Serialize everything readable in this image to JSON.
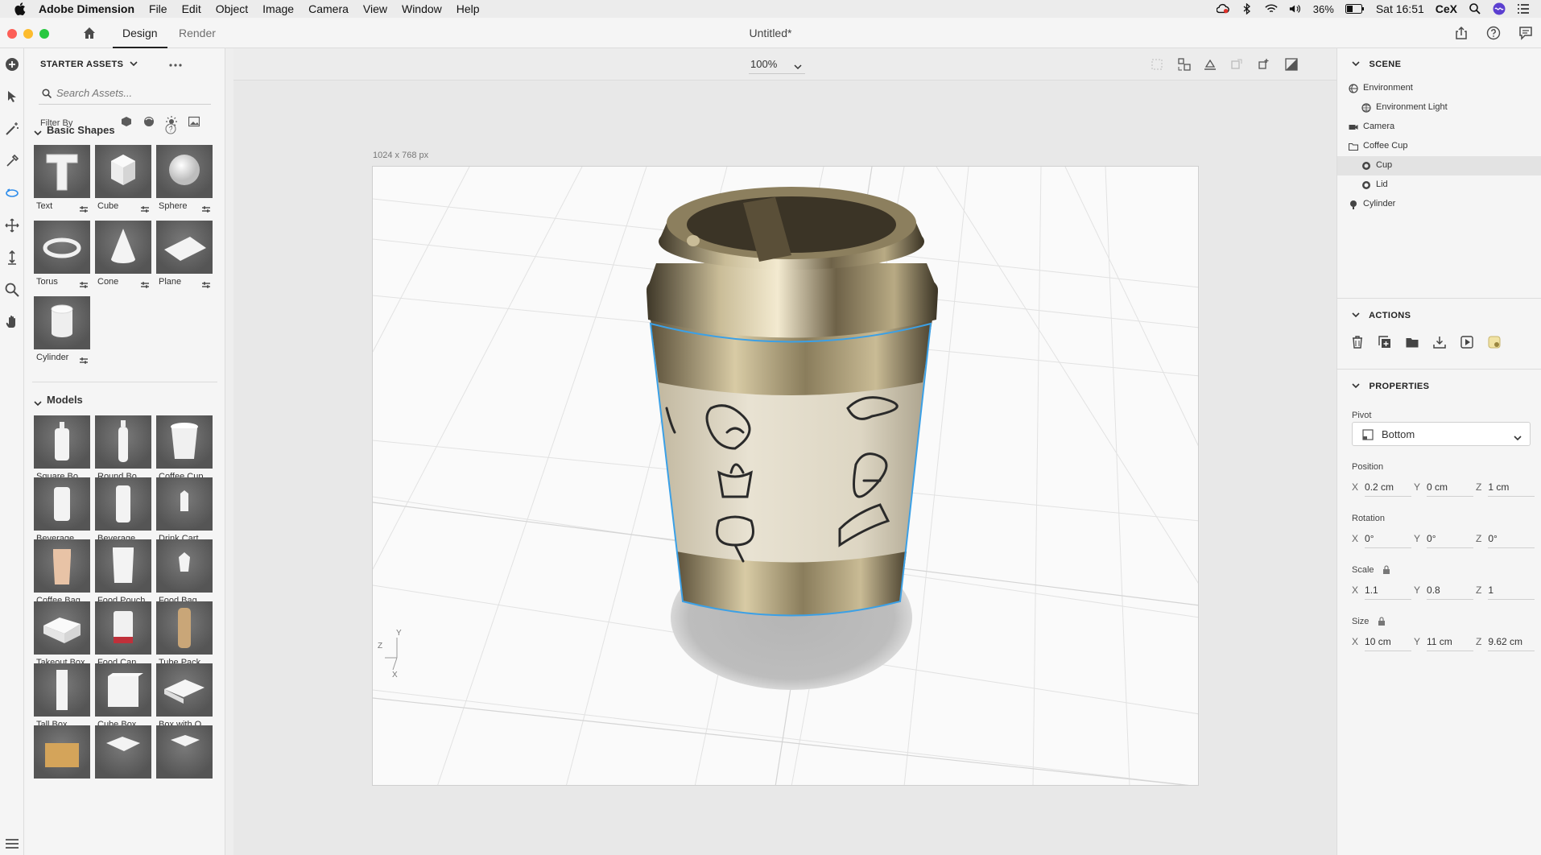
{
  "menubar": {
    "app_name": "Adobe Dimension",
    "menus": [
      "File",
      "Edit",
      "Object",
      "Image",
      "Camera",
      "View",
      "Window",
      "Help"
    ],
    "battery": "36%",
    "clock": "Sat 16:51",
    "user": "CeX"
  },
  "titlebar": {
    "tab_design": "Design",
    "tab_render": "Render",
    "document_title": "Untitled*"
  },
  "assets": {
    "header": "STARTER ASSETS",
    "search_placeholder": "Search Assets...",
    "filter_label": "Filter By",
    "basic_shapes_title": "Basic Shapes",
    "basic_shapes": [
      "Text",
      "Cube",
      "Sphere",
      "Torus",
      "Cone",
      "Plane",
      "Cylinder"
    ],
    "models_title": "Models",
    "models": [
      "Square Bo...",
      "Round Bo...",
      "Coffee Cup",
      "Beverage ...",
      "Beverage ...",
      "Drink Cart...",
      "Coffee Bag",
      "Food Pouch",
      "Food Bag",
      "Takeout Box",
      "Food Can",
      "Tube Pack...",
      "Tall Box",
      "Cube Box",
      "Box with O..."
    ]
  },
  "canvas": {
    "zoom": "100%",
    "canvas_size": "1024 x 768 px",
    "axis_y": "Y",
    "axis_z": "Z",
    "axis_x": "X"
  },
  "scene": {
    "header": "SCENE",
    "items": [
      "Environment",
      "Environment Light",
      "Camera",
      "Coffee Cup",
      "Cup",
      "Lid",
      "Cylinder"
    ],
    "selected": "Cup"
  },
  "actions": {
    "header": "ACTIONS"
  },
  "properties": {
    "header": "PROPERTIES",
    "pivot_label": "Pivot",
    "pivot_value": "Bottom",
    "position_label": "Position",
    "position": {
      "x": "0.2 cm",
      "y": "0 cm",
      "z": "1 cm"
    },
    "rotation_label": "Rotation",
    "rotation": {
      "x": "0°",
      "y": "0°",
      "z": "0°"
    },
    "scale_label": "Scale",
    "scale": {
      "x": "1.1",
      "y": "0.8",
      "z": "1"
    },
    "size_label": "Size",
    "size": {
      "x": "10 cm",
      "y": "11 cm",
      "z": "9.62 cm"
    },
    "axis_x": "X",
    "axis_y": "Y",
    "axis_z": "Z"
  },
  "colors": {
    "accent": "#2d8ceb",
    "selection_outline": "#3ba0e6",
    "traffic_red": "#fd5f57",
    "traffic_yellow": "#fdbc2e",
    "traffic_green": "#28c840"
  }
}
